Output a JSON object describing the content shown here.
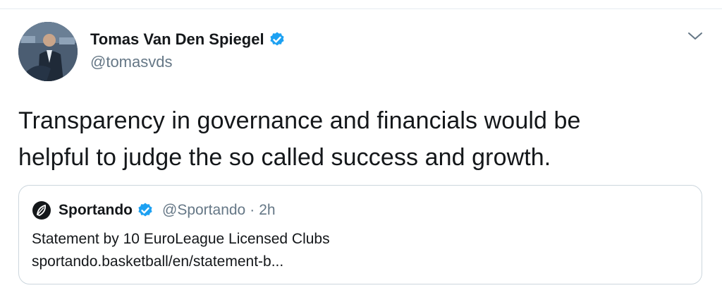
{
  "tweet": {
    "author": {
      "display_name": "Tomas Van Den Spiegel",
      "handle": "@tomasvds",
      "verified": true,
      "avatar": "avatar-photo"
    },
    "text": "Transparency in governance and financials would be\nhelpful to judge the so called success and growth.",
    "menu_icon": "chevron-down-icon"
  },
  "quote": {
    "author": {
      "display_name": "Sportando",
      "handle": "@Sportando",
      "verified": true,
      "logo": "sportando-logo-icon"
    },
    "separator": "·",
    "time": "2h",
    "title": "Statement by 10 EuroLeague Licensed Clubs",
    "link": "sportando.basketball/en/statement-b..."
  },
  "colors": {
    "text": "#14171a",
    "secondary_text": "#657786",
    "verified_blue": "#1da1f2",
    "border": "#ccd6dd"
  }
}
